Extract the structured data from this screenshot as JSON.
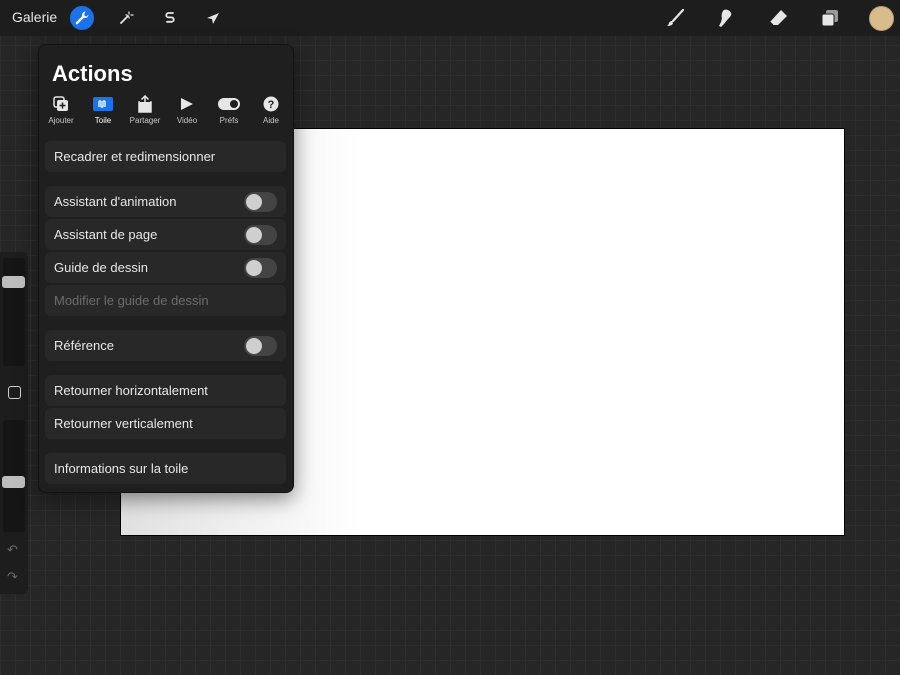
{
  "topbar": {
    "gallery_label": "Galerie",
    "tools": [
      {
        "name": "actions",
        "icon": "wrench-icon",
        "active": true
      },
      {
        "name": "adjustments",
        "icon": "magic-wand-icon",
        "active": false
      },
      {
        "name": "selection",
        "icon": "selection-s-icon",
        "active": false
      },
      {
        "name": "transform",
        "icon": "arrow-cursor-icon",
        "active": false
      }
    ],
    "right_tools": [
      {
        "name": "brush",
        "icon": "brush-icon"
      },
      {
        "name": "smudge",
        "icon": "smudge-finger-icon"
      },
      {
        "name": "eraser",
        "icon": "eraser-icon"
      },
      {
        "name": "layers",
        "icon": "layers-icon"
      }
    ],
    "color": "#d9bc8c"
  },
  "panel": {
    "title": "Actions",
    "tabs": [
      {
        "label": "Ajouter",
        "icon": "add-icon",
        "active": false
      },
      {
        "label": "Toile",
        "icon": "canvas-icon",
        "active": true
      },
      {
        "label": "Partager",
        "icon": "share-icon",
        "active": false
      },
      {
        "label": "Vidéo",
        "icon": "play-icon",
        "active": false
      },
      {
        "label": "Préfs",
        "icon": "toggle-prefs-icon",
        "active": false
      },
      {
        "label": "Aide",
        "icon": "help-icon",
        "active": false
      }
    ],
    "rows": [
      {
        "label": "Recadrer et redimensionner",
        "toggle": false,
        "disabled": false
      },
      {
        "label": "Assistant d'animation",
        "toggle": true,
        "on": false,
        "disabled": false
      },
      {
        "label": "Assistant de page",
        "toggle": true,
        "on": false,
        "disabled": false
      },
      {
        "label": "Guide de dessin",
        "toggle": true,
        "on": false,
        "disabled": false
      },
      {
        "label": "Modifier le guide de dessin",
        "toggle": false,
        "disabled": true
      },
      {
        "label": "Référence",
        "toggle": true,
        "on": false,
        "disabled": false
      },
      {
        "label": "Retourner horizontalement",
        "toggle": false,
        "disabled": false
      },
      {
        "label": "Retourner verticalement",
        "toggle": false,
        "disabled": false
      },
      {
        "label": "Informations sur la toile",
        "toggle": false,
        "disabled": false
      }
    ]
  },
  "sidebar": {
    "undo_icon": "undo-icon",
    "redo_icon": "redo-icon"
  },
  "colors": {
    "accent": "#1a73e8",
    "panel_bg": "#1f1f1f",
    "row_bg": "#282828"
  }
}
